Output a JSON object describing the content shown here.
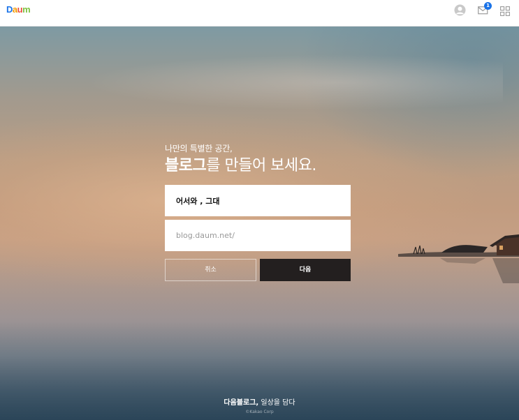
{
  "header": {
    "logo": {
      "letters": [
        "D",
        "a",
        "u",
        "m"
      ],
      "colors": [
        "#1a73e8",
        "#f59b00",
        "#ec4a39",
        "#7ec242"
      ]
    },
    "mail_badge_count": "1",
    "icons": [
      "profile-icon",
      "mail-icon",
      "app-grid-icon"
    ]
  },
  "hero": {
    "tagline": "나만의 특별한 공간,",
    "headline_bold": "블로그",
    "headline_rest": "를 만들어 보세요."
  },
  "form": {
    "name_value": "어서와 , 그대",
    "url_placeholder": "blog.daum.net/",
    "cancel_label": "취소",
    "next_label": "다음"
  },
  "footer": {
    "brand": "다음블로그,",
    "slogan": " 일상을 담다",
    "copyright": "©Kakao Corp"
  }
}
